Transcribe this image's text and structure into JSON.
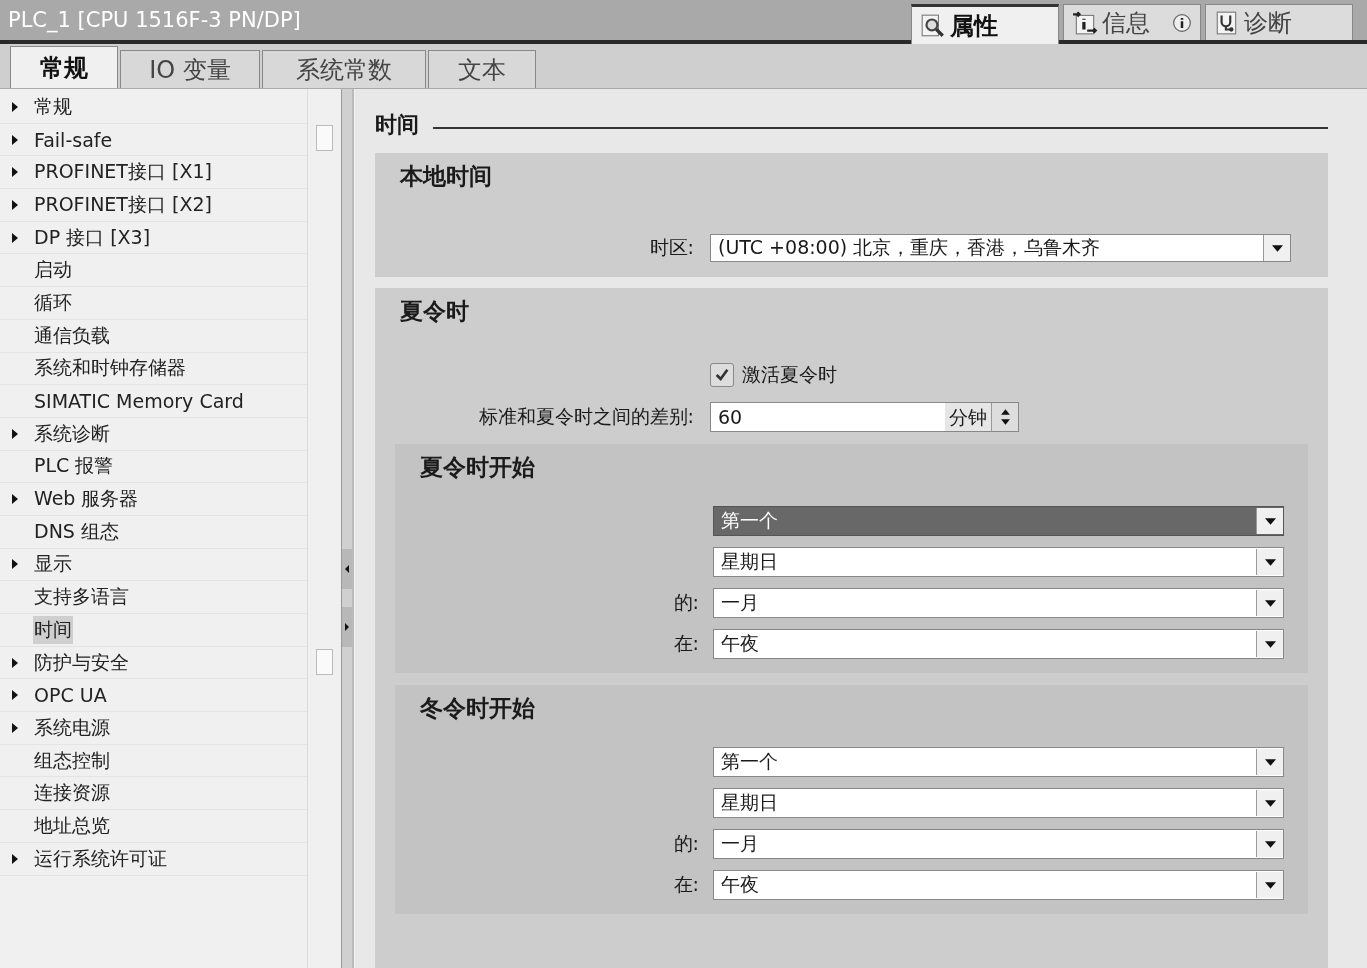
{
  "window": {
    "title": "PLC_1 [CPU 1516F-3 PN/DP]"
  },
  "inspector_tabs": [
    {
      "label": "属性",
      "kind": "properties",
      "selected": true
    },
    {
      "label": "信息",
      "kind": "info",
      "selected": false
    },
    {
      "label": "诊断",
      "kind": "diagnostics",
      "selected": false
    }
  ],
  "tabs": [
    {
      "label": "常规",
      "selected": true
    },
    {
      "label": "IO 变量",
      "selected": false
    },
    {
      "label": "系统常数",
      "selected": false
    },
    {
      "label": "文本",
      "selected": false
    }
  ],
  "nav": [
    {
      "label": "常规",
      "kind": "group",
      "selected": false
    },
    {
      "label": "Fail-safe",
      "kind": "group",
      "selected": false
    },
    {
      "label": "PROFINET接口 [X1]",
      "kind": "group",
      "selected": false
    },
    {
      "label": "PROFINET接口 [X2]",
      "kind": "group",
      "selected": false
    },
    {
      "label": "DP 接口 [X3]",
      "kind": "group",
      "selected": false
    },
    {
      "label": "启动",
      "kind": "leaf",
      "selected": false
    },
    {
      "label": "循环",
      "kind": "leaf",
      "selected": false
    },
    {
      "label": "通信负载",
      "kind": "leaf",
      "selected": false
    },
    {
      "label": "系统和时钟存储器",
      "kind": "leaf",
      "selected": false
    },
    {
      "label": "SIMATIC Memory Card",
      "kind": "leaf",
      "selected": false
    },
    {
      "label": "系统诊断",
      "kind": "group",
      "selected": false
    },
    {
      "label": "PLC 报警",
      "kind": "leaf",
      "selected": false
    },
    {
      "label": "Web 服务器",
      "kind": "group",
      "selected": false
    },
    {
      "label": "DNS 组态",
      "kind": "leaf",
      "selected": false
    },
    {
      "label": "显示",
      "kind": "group",
      "selected": false
    },
    {
      "label": "支持多语言",
      "kind": "leaf",
      "selected": false
    },
    {
      "label": "时间",
      "kind": "leaf",
      "selected": true
    },
    {
      "label": "防护与安全",
      "kind": "group",
      "selected": false
    },
    {
      "label": "OPC UA",
      "kind": "group",
      "selected": false
    },
    {
      "label": "系统电源",
      "kind": "group",
      "selected": false
    },
    {
      "label": "组态控制",
      "kind": "leaf",
      "selected": false
    },
    {
      "label": "连接资源",
      "kind": "leaf",
      "selected": false
    },
    {
      "label": "地址总览",
      "kind": "leaf",
      "selected": false
    },
    {
      "label": "运行系统许可证",
      "kind": "group",
      "selected": false
    }
  ],
  "content": {
    "title": "时间",
    "local_time": {
      "title": "本地时间",
      "timezone": {
        "label": "时区:",
        "value": "(UTC +08:00) 北京，重庆，香港，乌鲁木齐"
      }
    },
    "dst": {
      "title": "夏令时",
      "activate": {
        "label": "激活夏令时",
        "checked": true
      },
      "difference": {
        "label": "标准和夏令时之间的差别:",
        "value": "60",
        "unit": "分钟"
      },
      "periods": [
        {
          "title": "夏令时开始",
          "fields": [
            {
              "value": "第一个",
              "focused": true
            },
            {
              "value": "星期日",
              "focused": false
            },
            {
              "label": "的:",
              "value": "一月",
              "focused": false
            },
            {
              "label": "在:",
              "value": "午夜",
              "focused": false
            }
          ]
        },
        {
          "title": "冬令时开始",
          "fields": [
            {
              "value": "第一个",
              "focused": false
            },
            {
              "value": "星期日",
              "focused": false
            },
            {
              "label": "的:",
              "value": "一月",
              "focused": false
            },
            {
              "label": "在:",
              "value": "午夜",
              "focused": false
            }
          ]
        }
      ]
    }
  }
}
